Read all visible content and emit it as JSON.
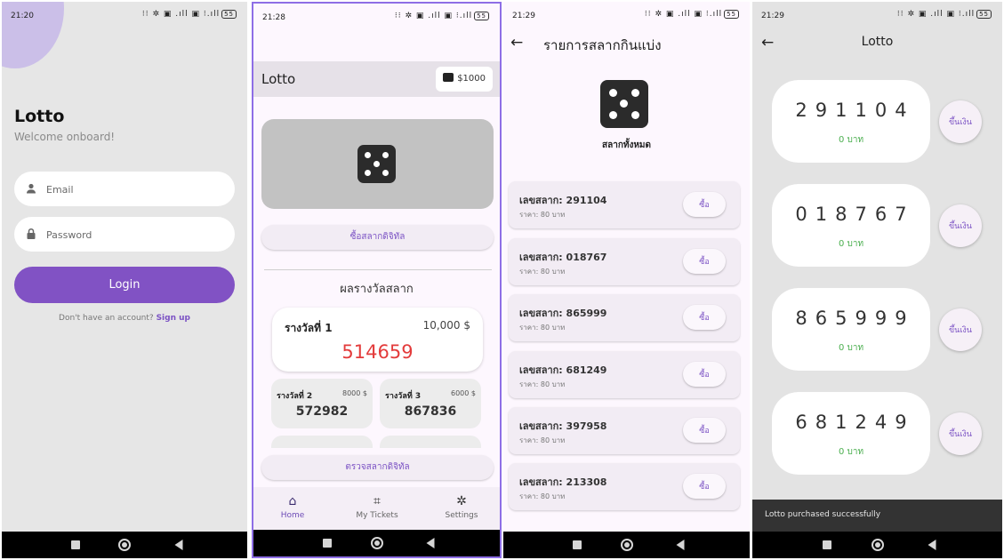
{
  "login": {
    "time": "21:20",
    "status_icons": "⁝⁝ ✲ ▣ .ıll ▣ ⁝.ıll",
    "battery": "55",
    "title": "Lotto",
    "subtitle": "Welcome onboard!",
    "email_placeholder": "Email",
    "password_placeholder": "Password",
    "login_label": "Login",
    "no_account_text": "Don't have an account?",
    "signup_label": "Sign up"
  },
  "home": {
    "time": "21:28",
    "status_icons": "⁝⁝ ✲ ▣ .ıll ▣ ⁝.ıll",
    "battery": "55",
    "title": "Lotto",
    "wallet": "$1000",
    "buy_digital_label": "ซื้อสลากดิจิทัล",
    "results_title": "ผลรางวัลสลาก",
    "prize1": {
      "label": "รางวัลที่ 1",
      "amount": "10,000 $",
      "number": "514659"
    },
    "prize2": {
      "label": "รางวัลที่ 2",
      "amount": "8000 $",
      "number": "572982"
    },
    "prize3": {
      "label": "รางวัลที่ 3",
      "amount": "6000 $",
      "number": "867836"
    },
    "check_label": "ตรวจสลากดิจิทัล",
    "nav": {
      "home": "Home",
      "tickets": "My Tickets",
      "settings": "Settings"
    },
    "accent": "#6d4bb6"
  },
  "list": {
    "time": "21:29",
    "status_icons": "⁝⁝ ✲ ▣ .ıll ▣ ⁝.ıll",
    "battery": "55",
    "title": "รายการสลากกินแบ่ง",
    "caption": "สลากทั้งหมด",
    "tickets": [
      {
        "number": "เลขสลาก: 291104",
        "price": "ราคา: 80 บาท",
        "buy": "ซื้อ"
      },
      {
        "number": "เลขสลาก: 018767",
        "price": "ราคา: 80 บาท",
        "buy": "ซื้อ"
      },
      {
        "number": "เลขสลาก: 865999",
        "price": "ราคา: 80 บาท",
        "buy": "ซื้อ"
      },
      {
        "number": "เลขสลาก: 681249",
        "price": "ราคา: 80 บาท",
        "buy": "ซื้อ"
      },
      {
        "number": "เลขสลาก: 397958",
        "price": "ราคา: 80 บาท",
        "buy": "ซื้อ"
      },
      {
        "number": "เลขสลาก: 213308",
        "price": "ราคา: 80 บาท",
        "buy": "ซื้อ"
      }
    ]
  },
  "mytickets": {
    "time": "21:29",
    "status_icons": "⁝⁝ ✲ ▣ .ıll ▣ ⁝.ıll",
    "battery": "55",
    "title": "Lotto",
    "tickets": [
      {
        "number": "291104",
        "value": "0 บาท",
        "cash": "ขึ้นเงิน"
      },
      {
        "number": "018767",
        "value": "0 บาท",
        "cash": "ขึ้นเงิน"
      },
      {
        "number": "865999",
        "value": "0 บาท",
        "cash": "ขึ้นเงิน"
      },
      {
        "number": "681249",
        "value": "0 บาท",
        "cash": "ขึ้นเงิน"
      }
    ],
    "snackbar": "Lotto purchased successfully"
  }
}
